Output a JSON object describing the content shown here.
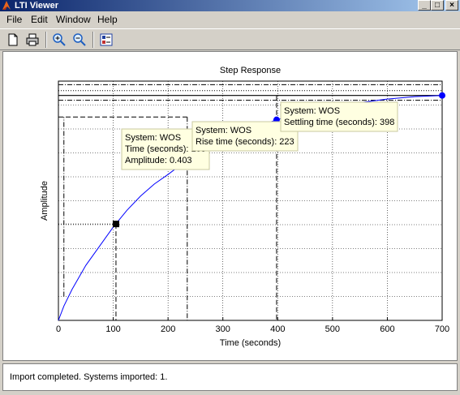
{
  "window": {
    "title": "LTI Viewer",
    "minimize": "_",
    "maximize": "□",
    "close": "×"
  },
  "menu": [
    "File",
    "Edit",
    "Window",
    "Help"
  ],
  "toolbar": {
    "icons": [
      "new-file-icon",
      "print-icon",
      "zoom-in-icon",
      "zoom-out-icon",
      "plot-config-icon"
    ]
  },
  "chart_data": {
    "type": "line",
    "title": "Step Response",
    "xlabel": "Time (seconds)",
    "ylabel": "Amplitude",
    "xlim": [
      0,
      700
    ],
    "xticks": [
      0,
      100,
      200,
      300,
      400,
      500,
      600,
      700
    ],
    "ylim": [
      0,
      1.0
    ],
    "grid": true,
    "series": [
      {
        "name": "WOS",
        "x": [
          0,
          10,
          25,
          50,
          75,
          100,
          125,
          150,
          175,
          200,
          235,
          275,
          300,
          350,
          400,
          450,
          500,
          550,
          600,
          650,
          700
        ],
        "y": [
          0,
          0.06,
          0.13,
          0.23,
          0.31,
          0.39,
          0.46,
          0.52,
          0.57,
          0.61,
          0.67,
          0.72,
          0.75,
          0.8,
          0.84,
          0.87,
          0.89,
          0.91,
          0.925,
          0.935,
          0.94
        ]
      }
    ],
    "reference_lines": {
      "final_value": 0.94,
      "upper_band": 0.96,
      "lower_band": 0.92,
      "peak_line": 0.985,
      "rise_start_time": 10,
      "rise_level": 0.85,
      "rise_time": 235,
      "settling_time": 398,
      "marker_time": 105,
      "marker_level": 0.403
    },
    "annotations": [
      {
        "lines": [
          "System: WOS",
          "Time (seconds): 105",
          "Amplitude: 0.403"
        ]
      },
      {
        "lines": [
          "System: WOS",
          "Rise time (seconds): 223"
        ]
      },
      {
        "lines": [
          "System: WOS",
          "Settling time (seconds): 398"
        ]
      }
    ]
  },
  "status": {
    "text": "Import completed. Systems imported: 1."
  }
}
